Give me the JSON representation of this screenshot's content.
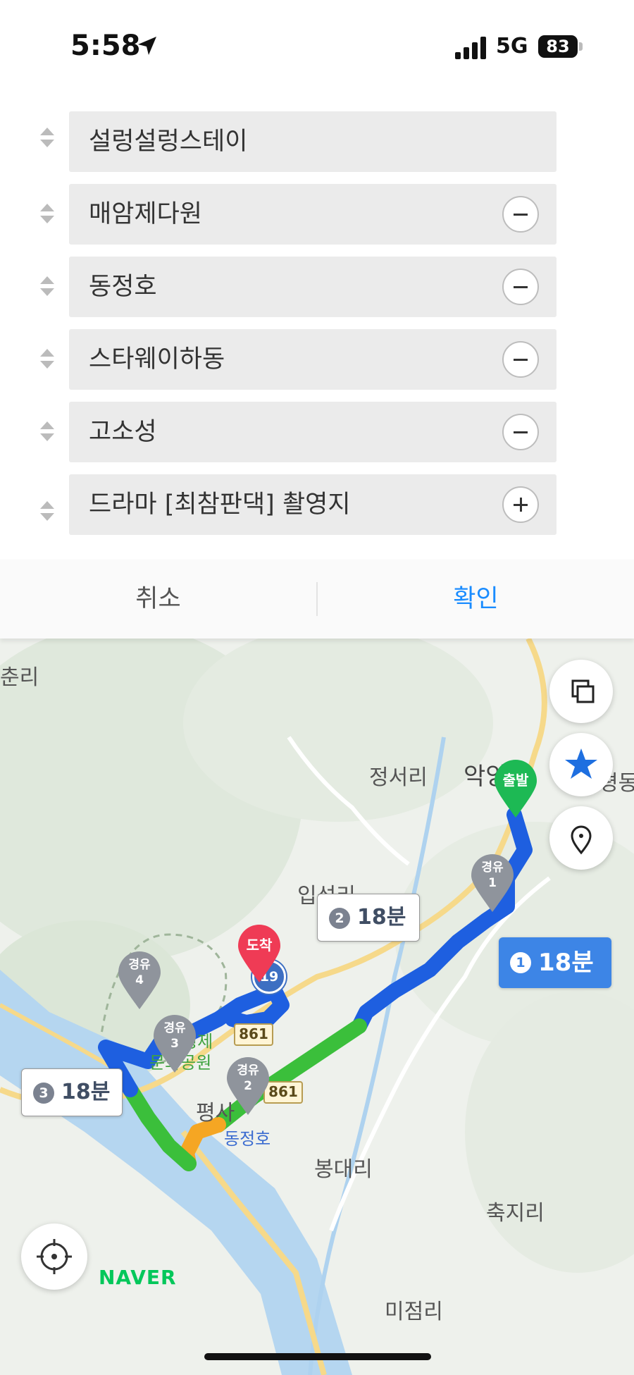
{
  "status_bar": {
    "time": "5:58",
    "network": "5G",
    "battery": "83"
  },
  "waypoints": [
    {
      "label": "설렁설렁스테이",
      "action": ""
    },
    {
      "label": "매암제다원",
      "action": "remove"
    },
    {
      "label": "동정호",
      "action": "remove"
    },
    {
      "label": "스타웨이하동",
      "action": "remove"
    },
    {
      "label": "고소성",
      "action": "remove"
    },
    {
      "label": "드라마 [최참판댁] 촬영지",
      "action": "add"
    }
  ],
  "actions": {
    "cancel": "취소",
    "confirm": "확인"
  },
  "map": {
    "places": [
      "춘리",
      "정서리",
      "악양면",
      "평동",
      "입석리",
      "평사",
      "동정호",
      "봉대리",
      "축지리",
      "미점리",
      "형제",
      "문화공원"
    ],
    "markers": {
      "start": "출발",
      "end": "도착",
      "via1": [
        "경유",
        "1"
      ],
      "via2": [
        "경유",
        "2"
      ],
      "via3": [
        "경유",
        "3"
      ],
      "via4": [
        "경유",
        "4"
      ]
    },
    "routes": [
      {
        "num": "1",
        "time": "18분"
      },
      {
        "num": "2",
        "time": "18분"
      },
      {
        "num": "3",
        "time": "18분"
      }
    ],
    "road_numbers": [
      "19",
      "861",
      "861"
    ],
    "brand": "NAVER",
    "colors": {
      "route_main": "#1e5fe0",
      "route_green": "#3bbf3b",
      "route_orange": "#f5a623",
      "start": "#1db954",
      "end": "#ef3b55",
      "via": "#8f949c"
    }
  }
}
